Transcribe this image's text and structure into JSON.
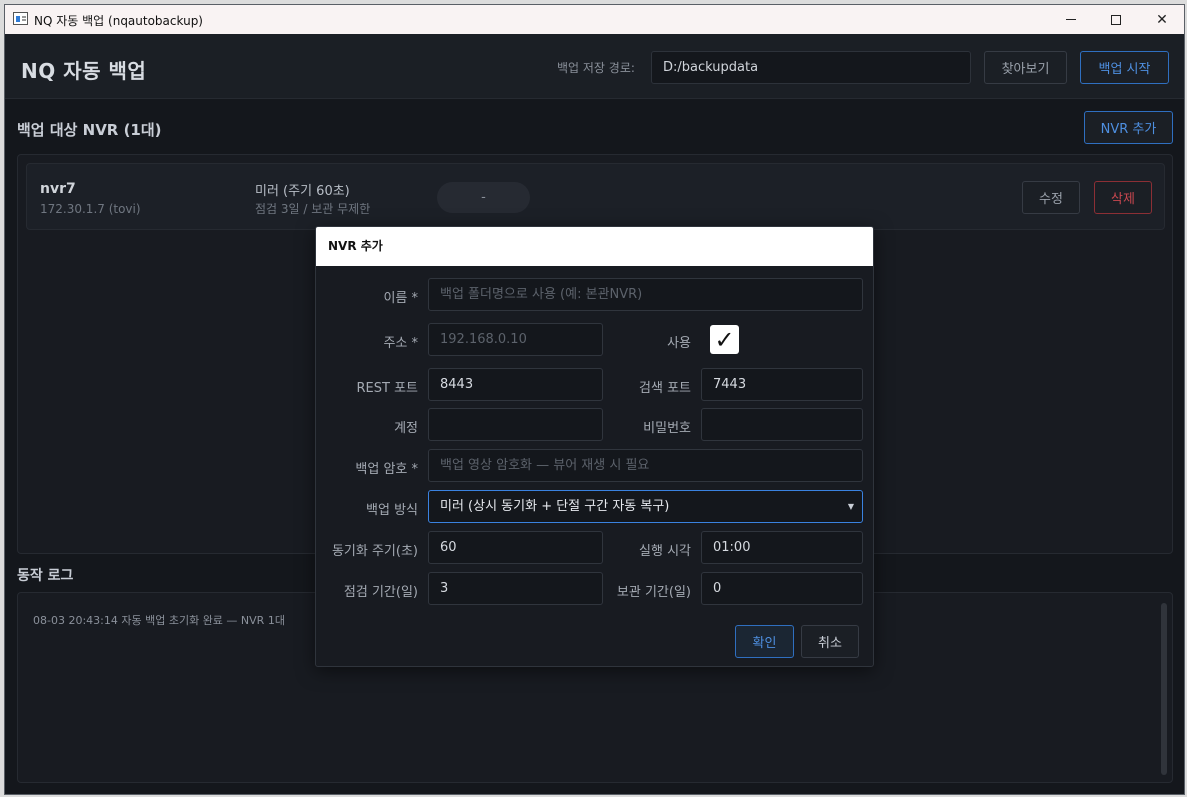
{
  "window": {
    "title": "NQ 자동 백업 (nqautobackup)"
  },
  "header": {
    "app_title": "NQ 자동 백업",
    "path_label": "백업 저장 경로:",
    "path_value": "D:/backupdata",
    "browse_label": "찾아보기",
    "start_label": "백업 시작"
  },
  "nvr_section": {
    "title": "백업 대상 NVR (1대)",
    "add_label": "NVR 추가",
    "items": [
      {
        "name": "nvr7",
        "address": "172.30.1.7  (tovi)",
        "mode": "미러 (주기 60초)",
        "sub": "점검 3일 / 보관 무제한",
        "status": "-",
        "edit_label": "수정",
        "delete_label": "삭제"
      }
    ]
  },
  "log": {
    "title": "동작 로그",
    "lines": [
      "08-03 20:43:14  자동 백업 초기화 완료 — NVR 1대"
    ]
  },
  "dialog": {
    "title": "NVR 추가",
    "name_label": "이름 *",
    "name_placeholder": "백업 폴더명으로 사용 (예: 본관NVR)",
    "address_label": "주소 *",
    "address_placeholder": "192.168.0.10",
    "enabled_label": "사용",
    "enabled": true,
    "rest_port_label": "REST 포트",
    "rest_port": "8443",
    "search_port_label": "검색 포트",
    "search_port": "7443",
    "account_label": "계정",
    "account": "",
    "password_label": "비밀번호",
    "password": "",
    "backup_pw_label": "백업 암호 *",
    "backup_pw_placeholder": "백업 영상 암호화 — 뷰어 재생 시 필요",
    "method_label": "백업 방식",
    "method_value": "미러 (상시 동기화 + 단절 구간 자동 복구)",
    "sync_interval_label": "동기화 주기(초)",
    "sync_interval": "60",
    "run_time_label": "실행 시각",
    "run_time": "01:00",
    "check_days_label": "점검 기간(일)",
    "check_days": "3",
    "retention_label": "보관 기간(일)",
    "retention": "0",
    "ok_label": "확인",
    "cancel_label": "취소"
  },
  "colors": {
    "background": "#14171c",
    "accent": "#3a82e0",
    "danger": "#c9474f"
  }
}
